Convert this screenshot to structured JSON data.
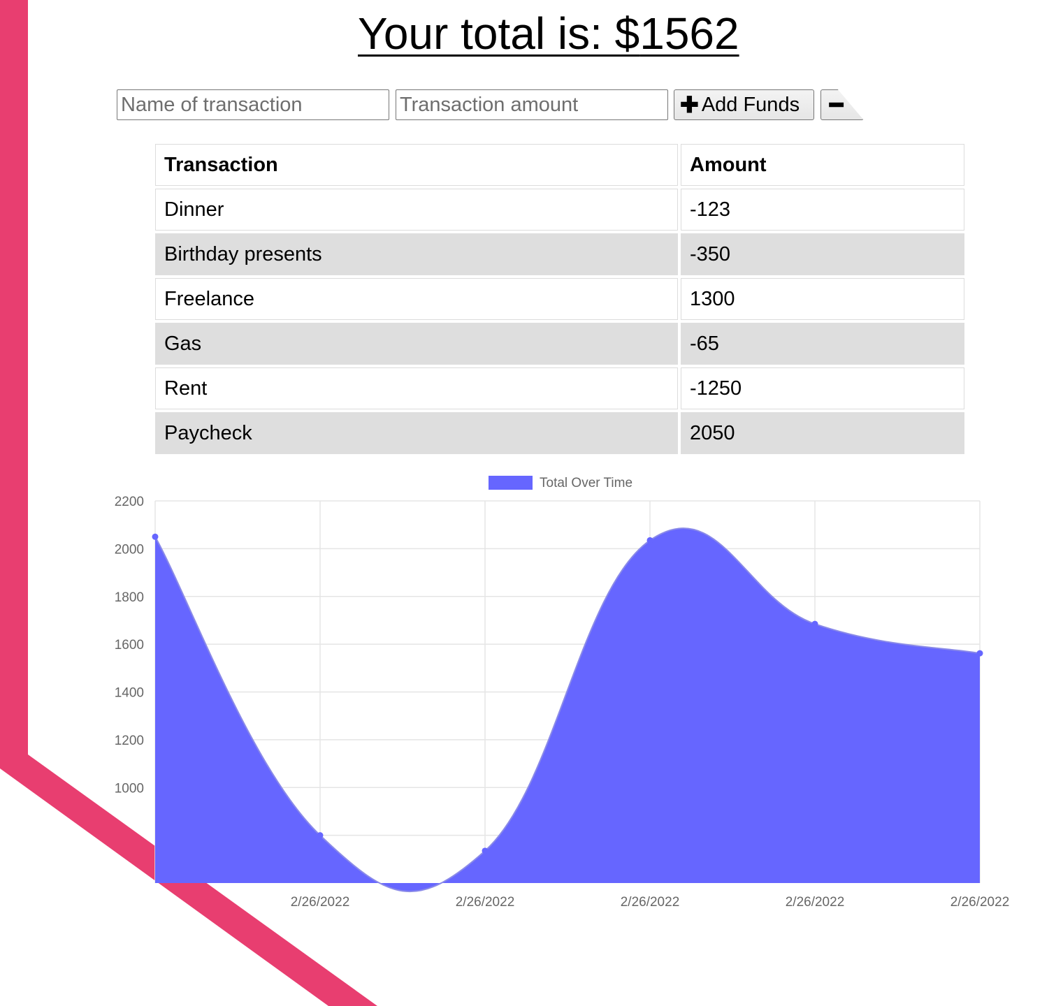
{
  "header": {
    "total_label": "Your total is: $",
    "total_value": "1562"
  },
  "form": {
    "name_placeholder": "Name of transaction",
    "amount_placeholder": "Transaction amount",
    "add_label": "Add Funds",
    "add_icon": "plus-icon",
    "sub_icon": "minus-icon"
  },
  "table": {
    "headers": [
      "Transaction",
      "Amount"
    ],
    "rows": [
      {
        "name": "Dinner",
        "amount": "-123"
      },
      {
        "name": "Birthday presents",
        "amount": "-350"
      },
      {
        "name": "Freelance",
        "amount": "1300"
      },
      {
        "name": "Gas",
        "amount": "-65"
      },
      {
        "name": "Rent",
        "amount": "-1250"
      },
      {
        "name": "Paycheck",
        "amount": "2050"
      }
    ]
  },
  "colors": {
    "accent": "#e83e70",
    "series_fill": "#6666ff",
    "row_stripe": "#dedede"
  },
  "chart_data": {
    "type": "area",
    "legend": {
      "label": "Total Over Time",
      "position": "top"
    },
    "x": [
      "2/26/2022",
      "2/26/2022",
      "2/26/2022",
      "2/26/2022",
      "2/26/2022",
      "2/26/2022"
    ],
    "x_tick_labels": [
      "2/26/2022",
      "2/26/2022",
      "2/26/2022",
      "2/26/2022",
      "2/26/2022"
    ],
    "series": [
      {
        "name": "Total Over Time",
        "values": [
          2050,
          800,
          735,
          2035,
          1685,
          1562
        ]
      }
    ],
    "y_ticks": [
      "2200",
      "2000",
      "1800",
      "1600",
      "1400",
      "1200",
      "1000"
    ],
    "ylim": [
      600,
      2200
    ],
    "grid": true
  }
}
